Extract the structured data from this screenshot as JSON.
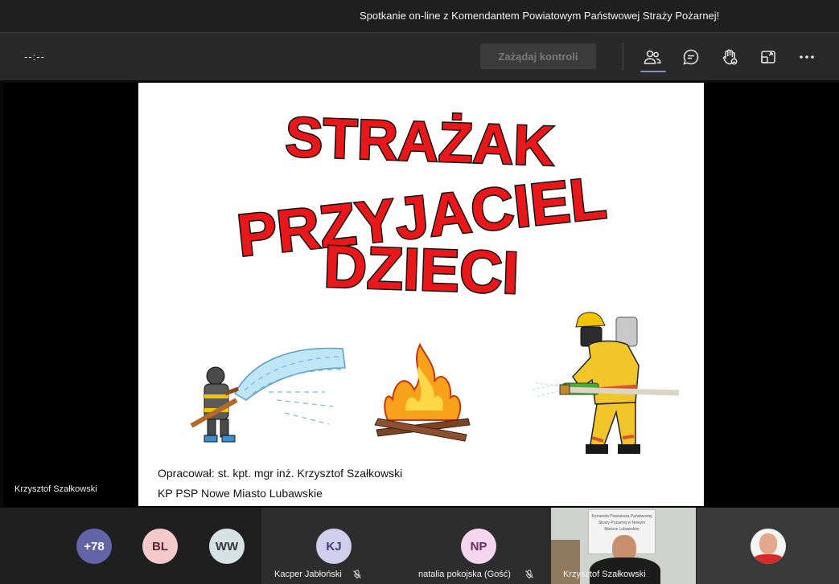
{
  "window": {
    "title": "Spotkanie on-line z Komendantem Powiatowym Państwowej Straży Pożarnej!"
  },
  "toolbar": {
    "timer": "--:--",
    "request_control_label": "Zażądaj kontroli",
    "icons": [
      "people-icon",
      "chat-icon",
      "raise-hand-icon",
      "share-tray-icon",
      "more-icon"
    ]
  },
  "slide": {
    "title_line1": "STRAŻAK",
    "title_line2": "PRZYJACIEL",
    "title_line3": "DZIECI",
    "credit_line1": "Opracował:  st. kpt. mgr inż. Krzysztof Szałkowski",
    "credit_line2": "KP PSP Nowe Miasto Lubawskie",
    "title_color": "#e8181a"
  },
  "presenter": {
    "name": "Krzysztof Szałkowski"
  },
  "participants": {
    "overflow": "+78",
    "bubbles": [
      {
        "initials": "BL",
        "color": "#f3c9cc",
        "text_color": "#5a2a2e"
      },
      {
        "initials": "WW",
        "color": "#d7e2e6",
        "text_color": "#2d3a40"
      }
    ],
    "tiles": [
      {
        "initials": "KJ",
        "name": "Kacper Jabłoński",
        "color": "#cfd0ee",
        "text_color": "#3b3e7a",
        "muted": true
      },
      {
        "initials": "NP",
        "name": "natalia pokojska (Gość)",
        "color": "#f6d5ee",
        "text_color": "#6a2a5c",
        "muted": true
      },
      {
        "name": "Krzysztof Szałkowski",
        "sign_text": "Komenda Powiatowa Państwowej Straży Pożarnej w Nowym Mieście Lubawskim"
      }
    ]
  }
}
